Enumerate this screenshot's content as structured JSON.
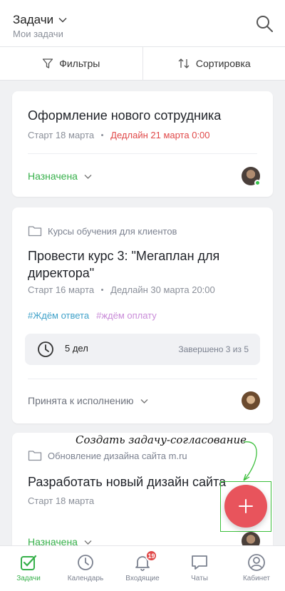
{
  "header": {
    "title": "Задачи",
    "subtitle": "Мои задачи"
  },
  "toolbar": {
    "filters_label": "Фильтры",
    "sort_label": "Сортировка"
  },
  "tasks": [
    {
      "title": "Оформление нового сотрудника",
      "start": "Старт 18 марта",
      "deadline": "Дедлайн 21 марта 0:00",
      "deadline_color": "#e04848",
      "status": "Назначена",
      "status_color": "#36b04a"
    },
    {
      "project": "Курсы обучения для клиентов",
      "title": "Провести курс 3: \"Мегаплан для директора\"",
      "start": "Старт 16 марта",
      "deadline": "Дедлайн 30 марта 20:00",
      "tags": [
        "#Ждём ответа",
        "#ждём оплату"
      ],
      "checklist_count": "5 дел",
      "checklist_done": "Завершено 3 из 5",
      "status": "Принята к исполнению"
    },
    {
      "project": "Обновление дизайна сайта m.ru",
      "title": "Разработать новый дизайн сайта",
      "start": "Старт 18 марта",
      "status": "Назначена",
      "status_color": "#36b04a"
    }
  ],
  "annotation": {
    "text": "Создать задачу-согласование"
  },
  "fab": {
    "icon": "plus-icon",
    "color": "#e8545c"
  },
  "nav": [
    {
      "label": "Задачи",
      "icon": "check-square-icon",
      "active": true
    },
    {
      "label": "Календарь",
      "icon": "clock-icon"
    },
    {
      "label": "Входящие",
      "icon": "bell-icon",
      "badge": "19"
    },
    {
      "label": "Чаты",
      "icon": "chat-icon"
    },
    {
      "label": "Кабинет",
      "icon": "user-icon"
    }
  ],
  "colors": {
    "accent_green": "#36b04a",
    "danger_red": "#e04848"
  }
}
